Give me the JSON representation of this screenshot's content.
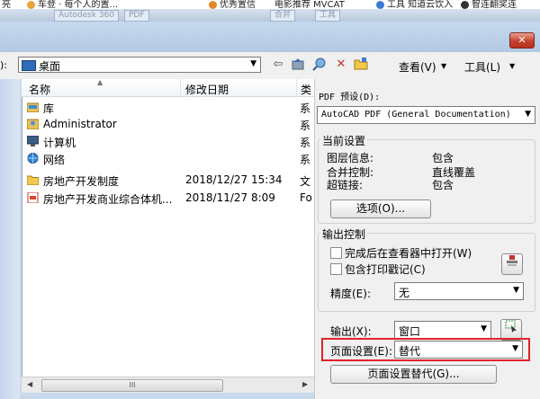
{
  "bookmarks": {
    "item1": "亮",
    "item2": "车登 · 每个人的置...",
    "item3": "优秀置信",
    "item4": "电影推荐 MVCAT",
    "item5": "工具 知道云饮入",
    "item6": "智连翻奖连"
  },
  "ribbon": {
    "tab1": "Autodesk 360",
    "tab2": "PDF",
    "tab3": "合并",
    "tab4": "工具"
  },
  "dialog": {
    "close_label": "✕"
  },
  "toolbar": {
    "lookin_label": "):",
    "lookin_value": "桌面",
    "view_label": "查看(V)",
    "tools_label": "工具(L)"
  },
  "file_list": {
    "col_name": "名称",
    "col_date": "修改日期",
    "col_type_cut": "类",
    "rows": [
      {
        "name": "库",
        "date": "",
        "cut": "系"
      },
      {
        "name": "Administrator",
        "date": "",
        "cut": "系"
      },
      {
        "name": "计算机",
        "date": "",
        "cut": "系"
      },
      {
        "name": "网络",
        "date": "",
        "cut": "系"
      },
      {
        "name": "房地产开发制度",
        "date": "2018/12/27 15:34",
        "cut": "文"
      },
      {
        "name": "房地产开发商业综合体机...",
        "date": "2018/11/27 8:09",
        "cut": "Fo"
      }
    ],
    "scroll_thumb": "III"
  },
  "right_panel": {
    "pdf_preset_label": "PDF 预设(D):",
    "pdf_preset_value": "AutoCAD PDF (General Documentation)",
    "current_settings": {
      "title": "当前设置",
      "layer_info_label": "图层信息:",
      "layer_info_value": "包含",
      "merge_control_label": "合并控制:",
      "merge_control_value": "直线覆盖",
      "hyperlink_label": "超链接:",
      "hyperlink_value": "包含",
      "options_button": "选项(O)..."
    },
    "output_control": {
      "title": "输出控制",
      "open_in_viewer": "完成后在查看器中打开(W)",
      "include_plot_stamp": "包含打印戳记(C)",
      "precision_label": "精度(E):",
      "precision_value": "无"
    },
    "export_label": "输出(X):",
    "export_value": "窗口",
    "page_setup_label": "页面设置(E):",
    "page_setup_value": "替代",
    "page_setup_override_button": "页面设置替代(G)..."
  }
}
